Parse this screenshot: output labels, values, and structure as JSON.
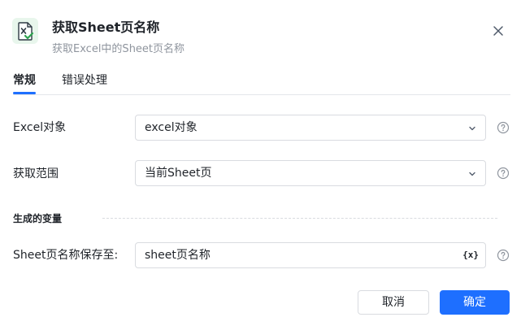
{
  "dialog": {
    "title": "获取Sheet页名称",
    "subtitle": "获取Excel中的Sheet页名称",
    "icon": "excel-sheet-icon"
  },
  "tabs": [
    {
      "label": "常规",
      "active": true
    },
    {
      "label": "错误处理",
      "active": false
    }
  ],
  "fields": {
    "excel_object": {
      "label": "Excel对象",
      "value": "excel对象"
    },
    "range": {
      "label": "获取范围",
      "value": "当前Sheet页"
    }
  },
  "output_section": {
    "label": "生成的变量"
  },
  "output_field": {
    "label": "Sheet页名称保存至:",
    "value": "sheet页名称",
    "var_button": "{x}"
  },
  "footer": {
    "cancel_label": "取消",
    "confirm_label": "确定"
  },
  "colors": {
    "primary": "#1e6fff",
    "icon_green": "#2ea44f"
  }
}
